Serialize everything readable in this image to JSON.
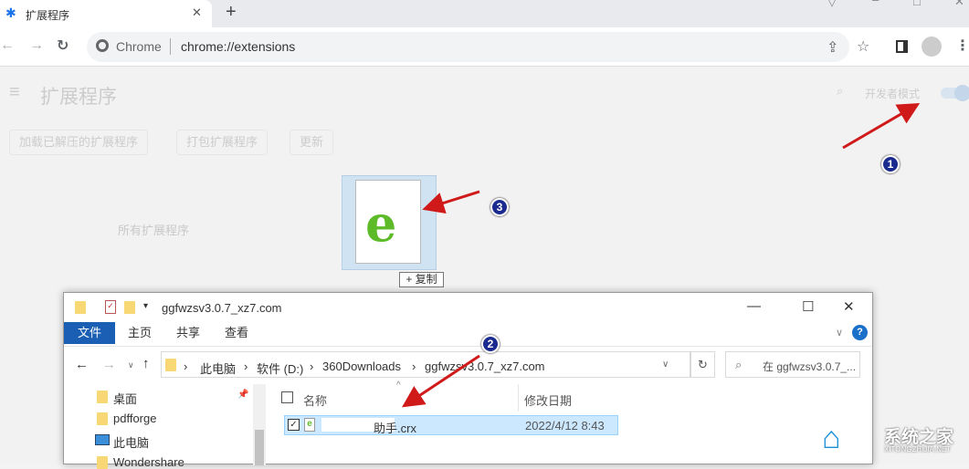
{
  "browser": {
    "tab_title": "扩展程序",
    "omnibox_site": "Chrome",
    "omnibox_url": "chrome://extensions"
  },
  "extensions_page": {
    "title": "扩展程序",
    "dev_mode_label": "开发者模式",
    "buttons": [
      "加载已解压的扩展程序",
      "打包扩展程序",
      "更新"
    ],
    "all_extensions": "所有扩展程序"
  },
  "drag": {
    "copy_label": "+ 复制"
  },
  "explorer": {
    "title": "ggfwzsv3.0.7_xz7.com",
    "ribbon_tabs": [
      "文件",
      "主页",
      "共享",
      "查看"
    ],
    "breadcrumb": [
      "此电脑",
      "软件 (D:)",
      "360Downloads",
      "ggfwzsv3.0.7_xz7.com"
    ],
    "search_placeholder": "在 ggfwzsv3.0.7_...",
    "nav_items": [
      "桌面",
      "pdfforge",
      "此电脑",
      "Wondershare"
    ],
    "columns": [
      "名称",
      "修改日期"
    ],
    "files": [
      {
        "name": "助手.crx",
        "modified": "2022/4/12 8:43"
      }
    ]
  },
  "annotations": [
    "1",
    "2",
    "3"
  ],
  "watermark": {
    "text": "系统之家",
    "sub": "XITONGZHIJIA.NET"
  },
  "colors": {
    "accent": "#1a5fb4",
    "annotation_arrow": "#d01a1a",
    "badge": "#1b2a8f"
  }
}
